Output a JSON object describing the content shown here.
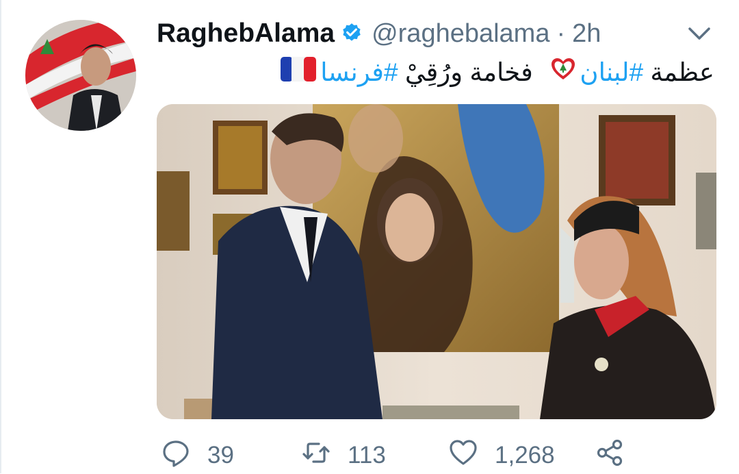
{
  "tweet": {
    "display_name": "RaghebAlama",
    "handle": "@raghebalama",
    "separator": "·",
    "time": "2h",
    "text": {
      "word1": "عظمة",
      "hashtag_lebanon": "#لبنان",
      "phrase": "فخامة ورُقِيْ",
      "hashtag_france": "#فرنسا"
    },
    "stats": {
      "replies": "39",
      "retweets": "113",
      "likes": "1,268"
    }
  },
  "colors": {
    "accent": "#1da1f2",
    "muted": "#5b7083",
    "text": "#0f1419"
  },
  "icons": [
    "verified-badge-icon",
    "chevron-down-icon",
    "reply-icon",
    "retweet-icon",
    "like-icon",
    "share-icon",
    "lebanon-heart-icon",
    "france-flag-icon"
  ]
}
